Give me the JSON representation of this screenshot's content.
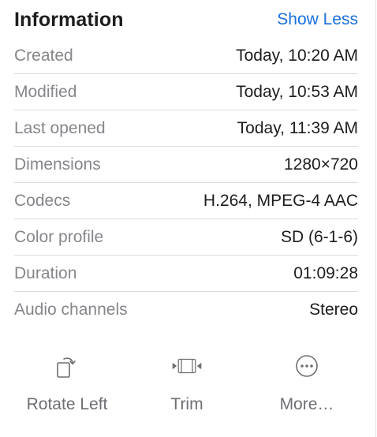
{
  "header": {
    "title": "Information",
    "toggle_label": "Show Less"
  },
  "info_rows": [
    {
      "label": "Created",
      "value": "Today, 10:20 AM"
    },
    {
      "label": "Modified",
      "value": "Today, 10:53 AM"
    },
    {
      "label": "Last opened",
      "value": "Today, 11:39 AM"
    },
    {
      "label": "Dimensions",
      "value": "1280×720"
    },
    {
      "label": "Codecs",
      "value": "H.264, MPEG-4 AAC"
    },
    {
      "label": "Color profile",
      "value": "SD (6-1-6)"
    },
    {
      "label": "Duration",
      "value": "01:09:28"
    },
    {
      "label": "Audio channels",
      "value": "Stereo"
    }
  ],
  "actions": [
    {
      "label": "Rotate Left",
      "icon": "rotate-left-icon"
    },
    {
      "label": "Trim",
      "icon": "trim-icon"
    },
    {
      "label": "More…",
      "icon": "more-icon"
    }
  ],
  "colors": {
    "link": "#1a6fdc",
    "label": "#86868b",
    "value": "#1d1d1f",
    "divider": "#dcdcdc"
  }
}
